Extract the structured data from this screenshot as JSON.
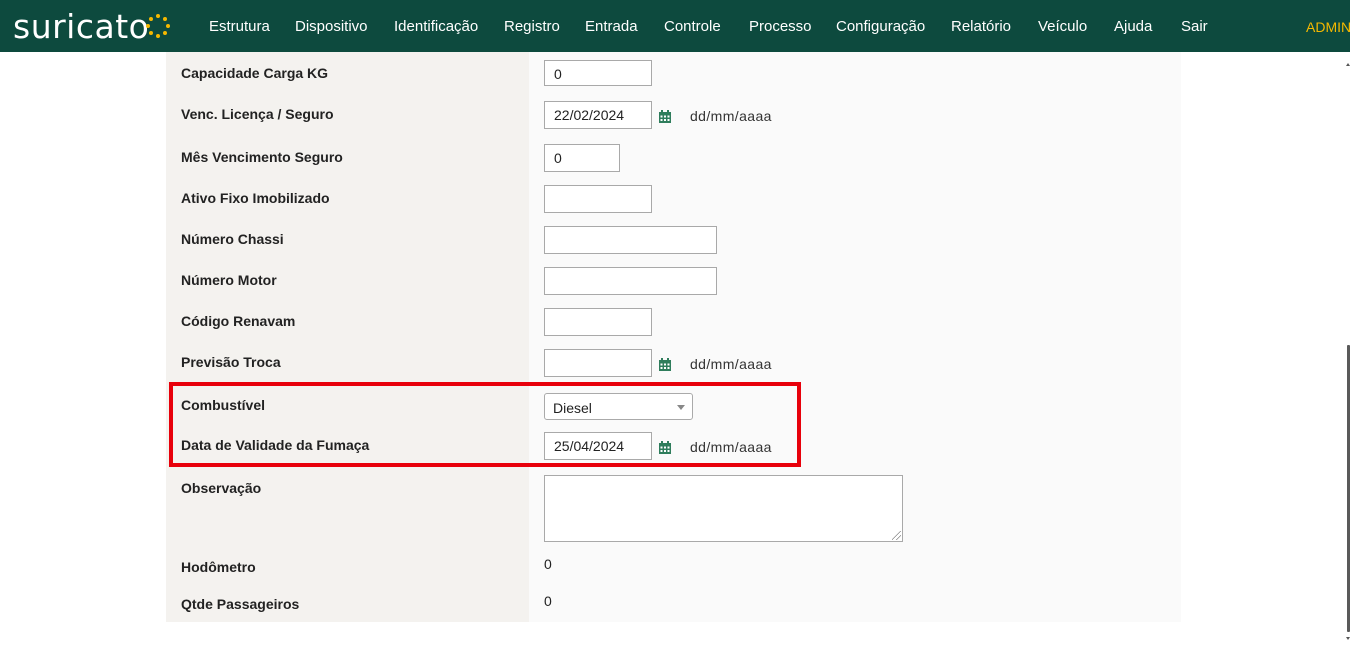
{
  "app": {
    "logo_text": "suricato",
    "nav": [
      {
        "label": "Estrutura"
      },
      {
        "label": "Dispositivo"
      },
      {
        "label": "Identificação"
      },
      {
        "label": "Registro"
      },
      {
        "label": "Entrada"
      },
      {
        "label": "Controle"
      },
      {
        "label": "Processo"
      },
      {
        "label": "Configuração"
      },
      {
        "label": "Relatório"
      },
      {
        "label": "Veículo"
      },
      {
        "label": "Ajuda"
      },
      {
        "label": "Sair"
      }
    ],
    "user": "ADMIN"
  },
  "form": {
    "capacidade": {
      "label": "Capacidade Carga KG",
      "value": "0"
    },
    "venc_licenca": {
      "label": "Venc. Licença / Seguro",
      "value": "22/02/2024",
      "hint": "dd/mm/aaaa"
    },
    "mes_venc": {
      "label": "Mês Vencimento Seguro",
      "value": "0"
    },
    "ativo_fixo": {
      "label": "Ativo Fixo Imobilizado",
      "value": ""
    },
    "numero_chassi": {
      "label": "Número Chassi",
      "value": ""
    },
    "numero_motor": {
      "label": "Número Motor",
      "value": ""
    },
    "codigo_renavam": {
      "label": "Código Renavam",
      "value": ""
    },
    "previsao_troca": {
      "label": "Previsão Troca",
      "value": "",
      "hint": "dd/mm/aaaa"
    },
    "combustivel": {
      "label": "Combustível",
      "value": "Diesel"
    },
    "data_fumaca": {
      "label": "Data de Validade da Fumaça",
      "value": "25/04/2024",
      "hint": "dd/mm/aaaa"
    },
    "observacao": {
      "label": "Observação",
      "value": ""
    },
    "hodometro": {
      "label": "Hodômetro",
      "value": "0"
    },
    "qtde_passageiros": {
      "label": "Qtde Passageiros",
      "value": "0"
    }
  },
  "icons": {
    "calendar": "calendar-icon"
  },
  "colors": {
    "topbar": "#0d4a3e",
    "accent": "#f5b800",
    "calendar": "#2f7d5c",
    "highlight": "#e8000b"
  }
}
